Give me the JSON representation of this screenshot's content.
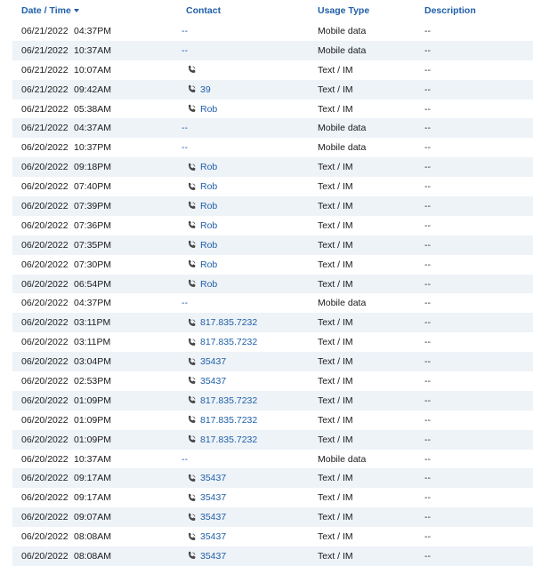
{
  "headers": {
    "date_time": "Date / Time",
    "contact": "Contact",
    "usage_type": "Usage Type",
    "description": "Description"
  },
  "rows": [
    {
      "date": "06/21/2022",
      "time": "04:37PM",
      "contact": "--",
      "phone": false,
      "type": "Mobile data",
      "desc": "--"
    },
    {
      "date": "06/21/2022",
      "time": "10:37AM",
      "contact": "--",
      "phone": false,
      "type": "Mobile data",
      "desc": "--"
    },
    {
      "date": "06/21/2022",
      "time": "10:07AM",
      "contact": "",
      "phone": true,
      "type": "Text / IM",
      "desc": "--"
    },
    {
      "date": "06/21/2022",
      "time": "09:42AM",
      "contact": "39",
      "phone": true,
      "type": "Text / IM",
      "desc": "--"
    },
    {
      "date": "06/21/2022",
      "time": "05:38AM",
      "contact": "Rob",
      "phone": true,
      "type": "Text / IM",
      "desc": "--"
    },
    {
      "date": "06/21/2022",
      "time": "04:37AM",
      "contact": "--",
      "phone": false,
      "type": "Mobile data",
      "desc": "--"
    },
    {
      "date": "06/20/2022",
      "time": "10:37PM",
      "contact": "--",
      "phone": false,
      "type": "Mobile data",
      "desc": "--"
    },
    {
      "date": "06/20/2022",
      "time": "09:18PM",
      "contact": "Rob",
      "phone": true,
      "type": "Text / IM",
      "desc": "--"
    },
    {
      "date": "06/20/2022",
      "time": "07:40PM",
      "contact": "Rob",
      "phone": true,
      "type": "Text / IM",
      "desc": "--"
    },
    {
      "date": "06/20/2022",
      "time": "07:39PM",
      "contact": "Rob",
      "phone": true,
      "type": "Text / IM",
      "desc": "--"
    },
    {
      "date": "06/20/2022",
      "time": "07:36PM",
      "contact": "Rob",
      "phone": true,
      "type": "Text / IM",
      "desc": "--"
    },
    {
      "date": "06/20/2022",
      "time": "07:35PM",
      "contact": "Rob",
      "phone": true,
      "type": "Text / IM",
      "desc": "--"
    },
    {
      "date": "06/20/2022",
      "time": "07:30PM",
      "contact": "Rob",
      "phone": true,
      "type": "Text / IM",
      "desc": "--"
    },
    {
      "date": "06/20/2022",
      "time": "06:54PM",
      "contact": "Rob",
      "phone": true,
      "type": "Text / IM",
      "desc": "--"
    },
    {
      "date": "06/20/2022",
      "time": "04:37PM",
      "contact": "--",
      "phone": false,
      "type": "Mobile data",
      "desc": "--"
    },
    {
      "date": "06/20/2022",
      "time": "03:11PM",
      "contact": "817.835.7232",
      "phone": true,
      "type": "Text / IM",
      "desc": "--"
    },
    {
      "date": "06/20/2022",
      "time": "03:11PM",
      "contact": "817.835.7232",
      "phone": true,
      "type": "Text / IM",
      "desc": "--"
    },
    {
      "date": "06/20/2022",
      "time": "03:04PM",
      "contact": "35437",
      "phone": true,
      "type": "Text / IM",
      "desc": "--"
    },
    {
      "date": "06/20/2022",
      "time": "02:53PM",
      "contact": "35437",
      "phone": true,
      "type": "Text / IM",
      "desc": "--"
    },
    {
      "date": "06/20/2022",
      "time": "01:09PM",
      "contact": "817.835.7232",
      "phone": true,
      "type": "Text / IM",
      "desc": "--"
    },
    {
      "date": "06/20/2022",
      "time": "01:09PM",
      "contact": "817.835.7232",
      "phone": true,
      "type": "Text / IM",
      "desc": "--"
    },
    {
      "date": "06/20/2022",
      "time": "01:09PM",
      "contact": "817.835.7232",
      "phone": true,
      "type": "Text / IM",
      "desc": "--"
    },
    {
      "date": "06/20/2022",
      "time": "10:37AM",
      "contact": "--",
      "phone": false,
      "type": "Mobile data",
      "desc": "--"
    },
    {
      "date": "06/20/2022",
      "time": "09:17AM",
      "contact": "35437",
      "phone": true,
      "type": "Text / IM",
      "desc": "--"
    },
    {
      "date": "06/20/2022",
      "time": "09:17AM",
      "contact": "35437",
      "phone": true,
      "type": "Text / IM",
      "desc": "--"
    },
    {
      "date": "06/20/2022",
      "time": "09:07AM",
      "contact": "35437",
      "phone": true,
      "type": "Text / IM",
      "desc": "--"
    },
    {
      "date": "06/20/2022",
      "time": "08:08AM",
      "contact": "35437",
      "phone": true,
      "type": "Text / IM",
      "desc": "--"
    },
    {
      "date": "06/20/2022",
      "time": "08:08AM",
      "contact": "35437",
      "phone": true,
      "type": "Text / IM",
      "desc": "--"
    }
  ],
  "colors": {
    "link": "#1f5fa8",
    "row_stripe": "#eef3f8"
  },
  "icons": {
    "phone": "phone-icon",
    "sort": "sort-descending-icon"
  }
}
